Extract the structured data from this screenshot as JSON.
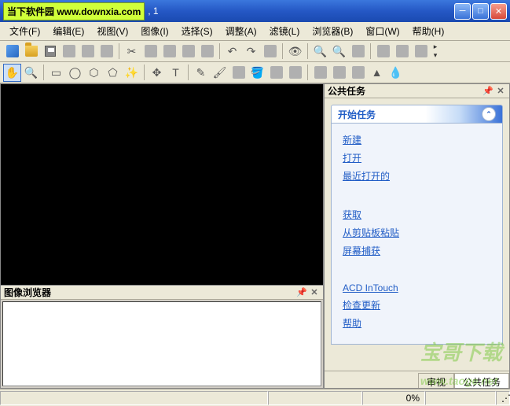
{
  "title_badge": "当下软件园 www.downxia.com",
  "title_suffix": ", 1",
  "menu": {
    "file": "文件(F)",
    "edit": "编辑(E)",
    "view": "视图(V)",
    "image": "图像(I)",
    "select": "选择(S)",
    "adjust": "调整(A)",
    "filter": "滤镜(L)",
    "browser": "浏览器(B)",
    "window": "窗口(W)",
    "help": "帮助(H)"
  },
  "panel": {
    "browser_title": "图像浏览器",
    "tasks_title": "公共任务"
  },
  "tasks": {
    "section_title": "开始任务",
    "links": {
      "new": "新建",
      "open": "打开",
      "recent": "最近打开的",
      "acquire": "获取",
      "paste_clip": "从剪贴板粘贴",
      "screen_cap": "屏幕捕获",
      "acd": "ACD InTouch",
      "update": "检查更新",
      "help": "帮助"
    },
    "tabs": {
      "review": "审视",
      "public": "公共任务"
    }
  },
  "status": {
    "percent": "0%"
  },
  "watermark": "宝哥下载",
  "watermark_url": "www.taoge.net"
}
